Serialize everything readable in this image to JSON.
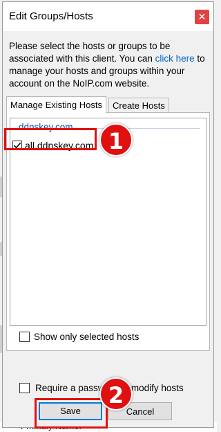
{
  "dialog": {
    "title": "Edit Groups/Hosts",
    "close_glyph": "✕",
    "intro_before": "Please select the hosts or groups to be associated with this client. You can ",
    "intro_link": "click here",
    "intro_after": " to manage your hosts and groups within your account on the NoIP.com website."
  },
  "tabs": [
    {
      "label": "Manage Existing Hosts",
      "active": true
    },
    {
      "label": "Create Hosts",
      "active": false
    }
  ],
  "host_list": {
    "group_name": "ddnskey.com",
    "hosts": [
      {
        "label": "all.ddnskey.com",
        "checked": true
      }
    ]
  },
  "show_only_selected": {
    "label": "Show only selected hosts",
    "checked": false
  },
  "require_password": {
    "label": "Require a password to modify hosts",
    "checked": false
  },
  "buttons": {
    "save": "Save",
    "cancel": "Cancel"
  },
  "annotations": {
    "marker_1": "1",
    "marker_2": "2"
  },
  "background": {
    "bottom_text": "Friendly Name: ••"
  },
  "colors": {
    "accent": "#0078d7",
    "link": "#0066cc",
    "close": "#e04343",
    "annotation": "#e01010"
  }
}
